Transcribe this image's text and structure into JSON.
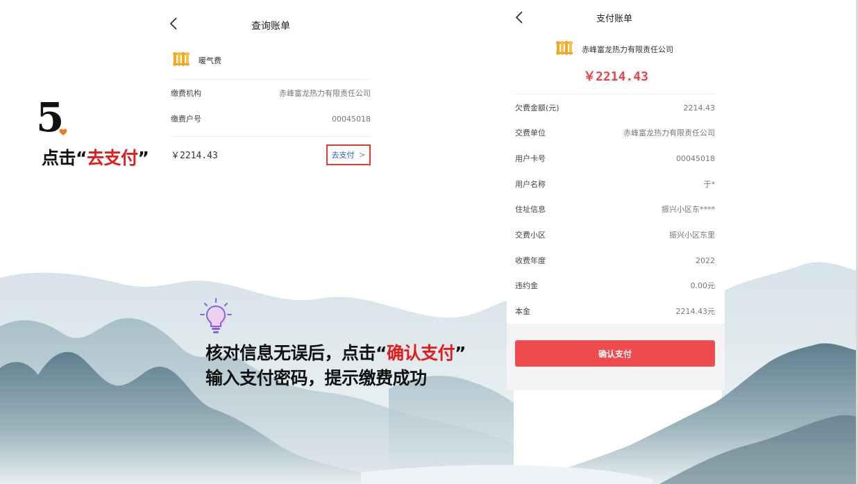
{
  "step": {
    "number": "5",
    "instruction_prefix": "点击“",
    "instruction_highlight": "去支付",
    "instruction_suffix": "”"
  },
  "query_bill": {
    "title": "查询账单",
    "service_icon": "radiator-icon",
    "service_name": "暖气费",
    "rows": [
      {
        "label": "缴费机构",
        "value": "赤峰富龙热力有限责任公司"
      },
      {
        "label": "缴费户号",
        "value": "00045018"
      }
    ],
    "amount": "￥2214.43",
    "pay_label": "去支付",
    "pay_chevron": ">"
  },
  "tip": {
    "icon": "lightbulb-icon",
    "line1_prefix": "核对信息无误后，点击“",
    "line1_highlight": "确认支付",
    "line1_suffix": "”",
    "line2": "输入支付密码，提示缴费成功"
  },
  "pay_bill": {
    "title": "支付账单",
    "company_icon": "radiator-icon",
    "company_name": "赤峰富龙热力有限责任公司",
    "amount": "￥2214.43",
    "rows": [
      {
        "label": "欠费金额(元)",
        "value": "2214.43"
      },
      {
        "label": "交费单位",
        "value": "赤峰富龙热力有限责任公司"
      },
      {
        "label": "用户卡号",
        "value": "00045018"
      },
      {
        "label": "用户名称",
        "value": "于*"
      },
      {
        "label": "住址信息",
        "value": "振兴小区东****"
      },
      {
        "label": "交费小区",
        "value": "振兴小区东里"
      },
      {
        "label": "收费年度",
        "value": "2022"
      },
      {
        "label": "违约金",
        "value": "0.00元"
      },
      {
        "label": "本金",
        "value": "2214.43元"
      }
    ],
    "confirm_label": "确认支付"
  },
  "colors": {
    "accent_red": "#e8191b",
    "button_red": "#ef4a4d",
    "link_blue": "#1f64c8",
    "icon_orange": "#f5a623"
  }
}
